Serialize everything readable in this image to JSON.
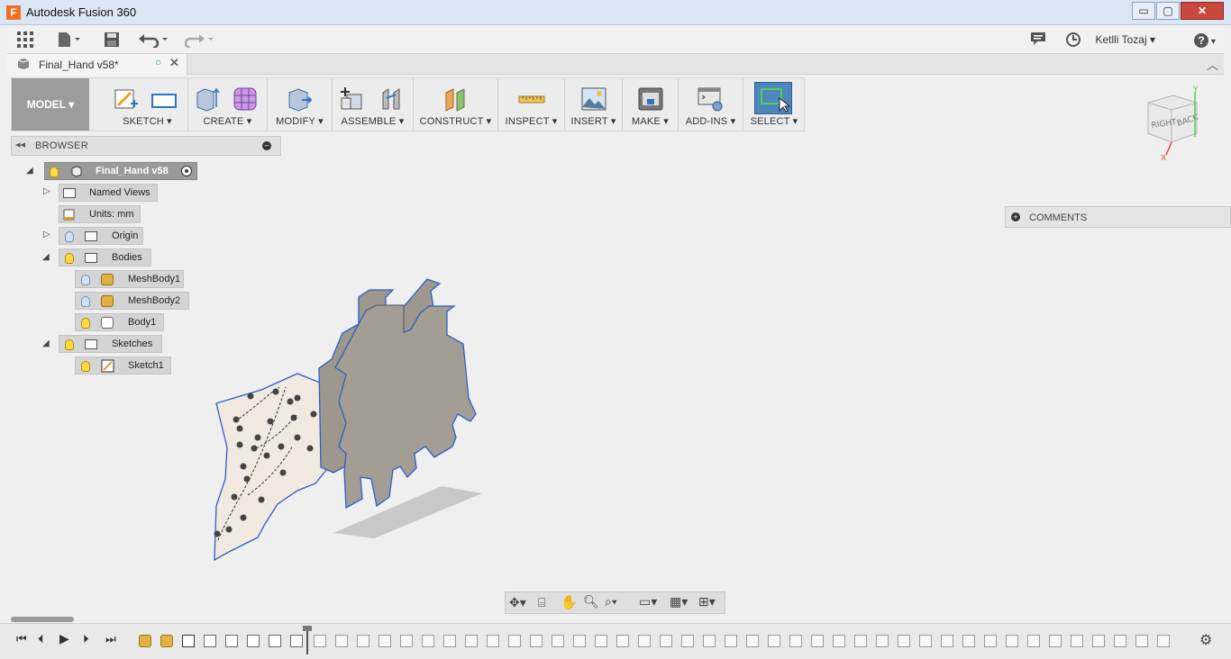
{
  "window": {
    "title": "Autodesk Fusion 360",
    "app_icon_letter": "F",
    "minimize": "▭",
    "maximize": "▢",
    "close": "✕"
  },
  "quick_access": {
    "user": "Ketlli Tozaj",
    "help": "?"
  },
  "document_tab": {
    "label": "Final_Hand v58*"
  },
  "toolbar": {
    "model": "MODEL ▾",
    "groups": [
      {
        "label": "SKETCH ▾"
      },
      {
        "label": "CREATE ▾"
      },
      {
        "label": "MODIFY ▾"
      },
      {
        "label": "ASSEMBLE ▾"
      },
      {
        "label": "CONSTRUCT ▾"
      },
      {
        "label": "INSPECT ▾"
      },
      {
        "label": "INSERT ▾"
      },
      {
        "label": "MAKE ▾"
      },
      {
        "label": "ADD-INS ▾"
      },
      {
        "label": "SELECT ▾"
      }
    ]
  },
  "browser": {
    "header": "BROWSER",
    "root": "Final_Hand v58",
    "items": [
      {
        "label": "Named Views"
      },
      {
        "label": "Units: mm"
      },
      {
        "label": "Origin"
      },
      {
        "label": "Bodies"
      },
      {
        "label": "MeshBody1"
      },
      {
        "label": "MeshBody2"
      },
      {
        "label": "Body1"
      },
      {
        "label": "Sketches"
      },
      {
        "label": "Sketch1"
      }
    ]
  },
  "comments": {
    "label": "COMMENTS"
  },
  "viewcube": {
    "right": "RIGHT",
    "back": "BACK",
    "x_axis": "X",
    "y_axis": "Y"
  }
}
